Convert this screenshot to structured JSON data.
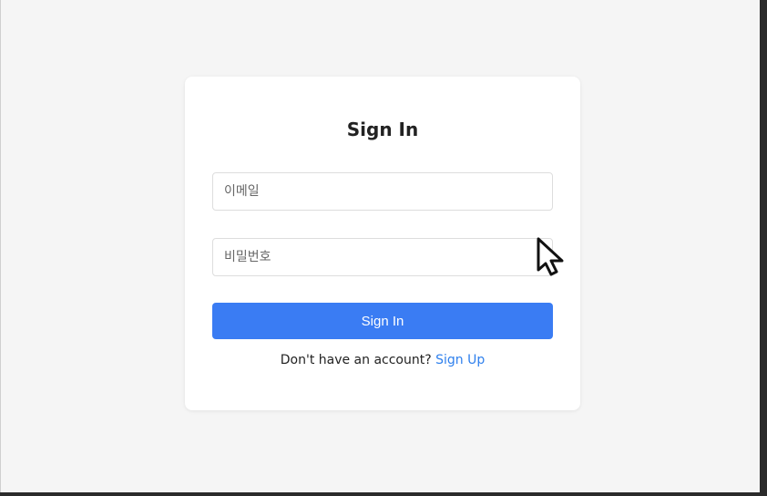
{
  "login": {
    "title": "Sign In",
    "email_placeholder": "이메일",
    "password_placeholder": "비밀번호",
    "submit_label": "Sign In",
    "signup_prompt": "Don't have an account?",
    "signup_link": "Sign Up"
  },
  "colors": {
    "background": "#f5f5f5",
    "card": "#ffffff",
    "primary_button": "#3a7cf3",
    "link": "#2f80ed",
    "text": "#222222"
  },
  "icons": {
    "cursor": "mouse-pointer-icon"
  }
}
